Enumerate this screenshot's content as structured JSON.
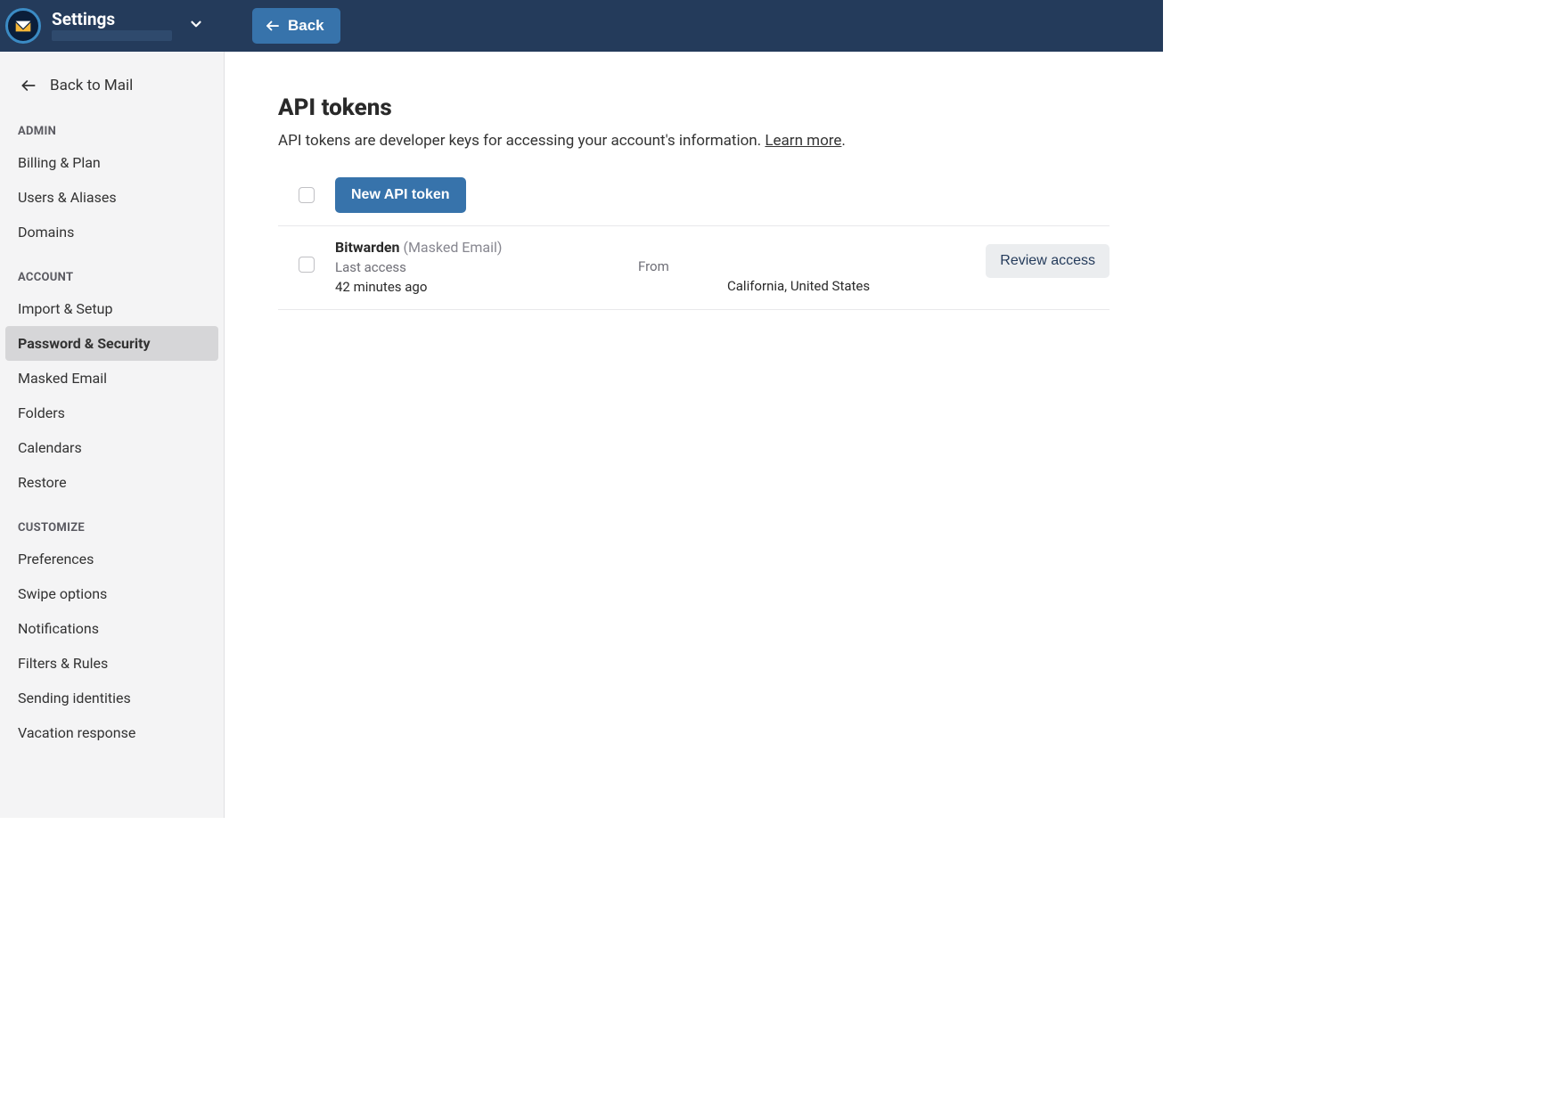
{
  "topbar": {
    "title": "Settings",
    "back_label": "Back"
  },
  "sidebar": {
    "back_to_mail": "Back to Mail",
    "groups": [
      {
        "label": "ADMIN",
        "items": [
          {
            "id": "billing",
            "label": "Billing & Plan",
            "active": false
          },
          {
            "id": "users",
            "label": "Users & Aliases",
            "active": false
          },
          {
            "id": "domains",
            "label": "Domains",
            "active": false
          }
        ]
      },
      {
        "label": "ACCOUNT",
        "items": [
          {
            "id": "import",
            "label": "Import & Setup",
            "active": false
          },
          {
            "id": "password",
            "label": "Password & Security",
            "active": true
          },
          {
            "id": "masked",
            "label": "Masked Email",
            "active": false
          },
          {
            "id": "folders",
            "label": "Folders",
            "active": false
          },
          {
            "id": "calendars",
            "label": "Calendars",
            "active": false
          },
          {
            "id": "restore",
            "label": "Restore",
            "active": false
          }
        ]
      },
      {
        "label": "CUSTOMIZE",
        "items": [
          {
            "id": "prefs",
            "label": "Preferences",
            "active": false
          },
          {
            "id": "swipe",
            "label": "Swipe options",
            "active": false
          },
          {
            "id": "notif",
            "label": "Notifications",
            "active": false
          },
          {
            "id": "filters",
            "label": "Filters & Rules",
            "active": false
          },
          {
            "id": "sending",
            "label": "Sending identities",
            "active": false
          },
          {
            "id": "vacation",
            "label": "Vacation response",
            "active": false
          }
        ]
      }
    ]
  },
  "content": {
    "heading": "API tokens",
    "intro_text": "API tokens are developer keys for accessing your account's information. ",
    "learn_more": "Learn more",
    "new_token_label": "New API token",
    "tokens": [
      {
        "name": "Bitwarden",
        "scope": "(Masked Email)",
        "last_access_label": "Last access",
        "last_access_value": "42 minutes ago",
        "from_label": "From",
        "location": "California, United States",
        "review_label": "Review access"
      }
    ]
  }
}
